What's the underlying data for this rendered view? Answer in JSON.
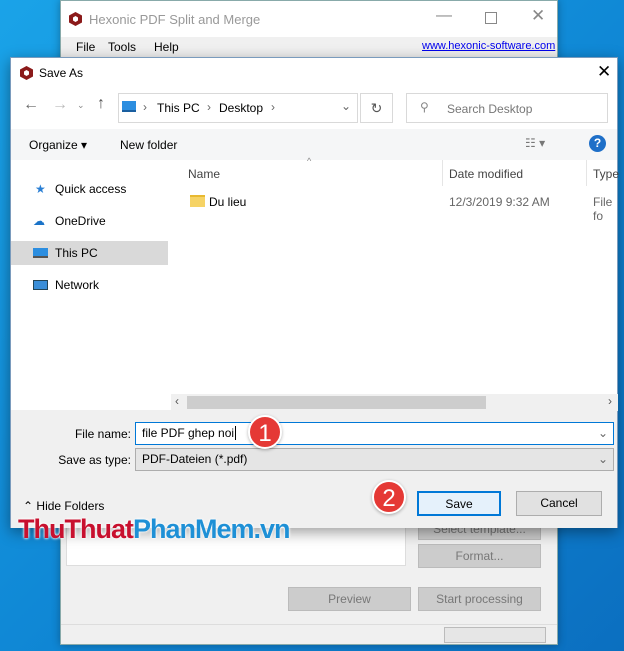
{
  "app_window": {
    "title": "Hexonic PDF Split and Merge",
    "menu": [
      "File",
      "Tools",
      "Help"
    ],
    "link": "www.hexonic-software.com",
    "buttons": {
      "select_template": "Select template...",
      "format": "Format...",
      "preview": "Preview",
      "start": "Start processing"
    }
  },
  "dialog": {
    "title": "Save As",
    "breadcrumb": [
      "This PC",
      "Desktop"
    ],
    "search_placeholder": "Search Desktop",
    "toolbar": {
      "organize": "Organize",
      "new_folder": "New folder"
    },
    "nav": [
      {
        "label": "Quick access",
        "icon": "star-icon"
      },
      {
        "label": "OneDrive",
        "icon": "cloud-icon"
      },
      {
        "label": "This PC",
        "icon": "computer-icon",
        "selected": true
      },
      {
        "label": "Network",
        "icon": "network-icon"
      }
    ],
    "columns": [
      "Name",
      "Date modified",
      "Type"
    ],
    "files": [
      {
        "name": "Du lieu",
        "date": "12/3/2019 9:32 AM",
        "type": "File fo"
      }
    ],
    "file_name_label": "File name:",
    "file_name_value": "file PDF ghep noi",
    "save_type_label": "Save as type:",
    "save_type_value": "PDF-Dateien (*.pdf)",
    "hide_folders": "Hide Folders",
    "save": "Save",
    "cancel": "Cancel"
  },
  "annotations": [
    "1",
    "2"
  ],
  "watermark": {
    "part1": "ThuThuat",
    "part2": "PhanMem",
    "part3": ".vn"
  },
  "colors": {
    "accent": "#0078d7",
    "badge": "#e53935",
    "watermark_red": "#c8102e",
    "watermark_blue": "#1e90d6"
  }
}
